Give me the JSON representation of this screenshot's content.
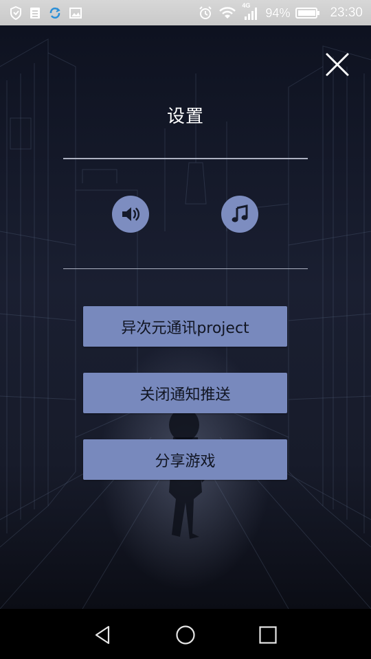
{
  "status_bar": {
    "left_icons": [
      "shield-icon",
      "sim-list-icon",
      "sync-icon",
      "image-icon"
    ],
    "right_icons": [
      "alarm-icon",
      "wifi-icon",
      "signal-4g-icon",
      "battery-icon"
    ],
    "network_label": "4G",
    "battery": "94%",
    "time": "23:30"
  },
  "settings": {
    "title": "设置",
    "close_icon": "close-icon",
    "sound_icon": "speaker-icon",
    "music_icon": "music-note-icon",
    "buttons": [
      {
        "label": "异次元通讯project"
      },
      {
        "label": "关闭通知推送"
      },
      {
        "label": "分享游戏"
      }
    ]
  },
  "nav_bar": {
    "icons": [
      "back-icon",
      "home-icon",
      "recents-icon"
    ]
  },
  "colors": {
    "button_bg": "#7889bd",
    "round_button_bg": "#7d8dc0",
    "background": "#151a2a",
    "status_bar": "#cfcfcf"
  }
}
